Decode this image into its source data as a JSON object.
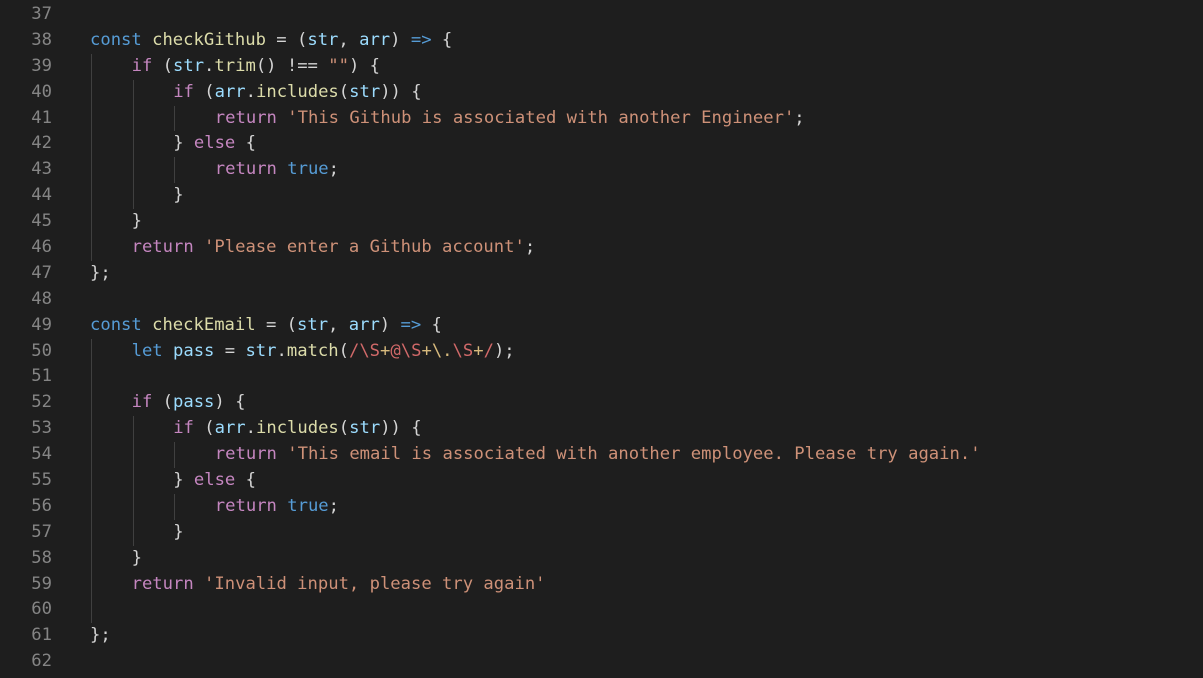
{
  "colors": {
    "background": "#1e1e1e",
    "line_number": "#858585",
    "default": "#d4d4d4",
    "storage": "#569cd6",
    "function": "#dcdcaa",
    "variable": "#9cdcfe",
    "control": "#c586c0",
    "string": "#ce9178",
    "regexp": "#d16969",
    "regex_escape": "#d7ba7d",
    "indent_guide": "#404040"
  },
  "editor": {
    "lines": [
      {
        "num": "37",
        "indent": 0,
        "tokens": []
      },
      {
        "num": "38",
        "indent": 0,
        "tokens": [
          {
            "t": "const",
            "k": "storage"
          },
          {
            "t": " ",
            "k": "default"
          },
          {
            "t": "checkGithub",
            "k": "function"
          },
          {
            "t": " = (",
            "k": "default"
          },
          {
            "t": "str",
            "k": "variable"
          },
          {
            "t": ", ",
            "k": "default"
          },
          {
            "t": "arr",
            "k": "variable"
          },
          {
            "t": ") ",
            "k": "default"
          },
          {
            "t": "=>",
            "k": "storage"
          },
          {
            "t": " {",
            "k": "default"
          }
        ]
      },
      {
        "num": "39",
        "indent": 1,
        "tokens": [
          {
            "t": "if",
            "k": "control"
          },
          {
            "t": " (",
            "k": "default"
          },
          {
            "t": "str",
            "k": "variable"
          },
          {
            "t": ".",
            "k": "default"
          },
          {
            "t": "trim",
            "k": "function"
          },
          {
            "t": "() !== ",
            "k": "default"
          },
          {
            "t": "\"\"",
            "k": "string"
          },
          {
            "t": ") {",
            "k": "default"
          }
        ]
      },
      {
        "num": "40",
        "indent": 2,
        "tokens": [
          {
            "t": "if",
            "k": "control"
          },
          {
            "t": " (",
            "k": "default"
          },
          {
            "t": "arr",
            "k": "variable"
          },
          {
            "t": ".",
            "k": "default"
          },
          {
            "t": "includes",
            "k": "function"
          },
          {
            "t": "(",
            "k": "default"
          },
          {
            "t": "str",
            "k": "variable"
          },
          {
            "t": ")) {",
            "k": "default"
          }
        ]
      },
      {
        "num": "41",
        "indent": 3,
        "tokens": [
          {
            "t": "return",
            "k": "control"
          },
          {
            "t": " ",
            "k": "default"
          },
          {
            "t": "'This Github is associated with another Engineer'",
            "k": "string"
          },
          {
            "t": ";",
            "k": "default"
          }
        ]
      },
      {
        "num": "42",
        "indent": 2,
        "tokens": [
          {
            "t": "} ",
            "k": "default"
          },
          {
            "t": "else",
            "k": "control"
          },
          {
            "t": " {",
            "k": "default"
          }
        ]
      },
      {
        "num": "43",
        "indent": 3,
        "tokens": [
          {
            "t": "return",
            "k": "control"
          },
          {
            "t": " ",
            "k": "default"
          },
          {
            "t": "true",
            "k": "storage"
          },
          {
            "t": ";",
            "k": "default"
          }
        ]
      },
      {
        "num": "44",
        "indent": 2,
        "tokens": [
          {
            "t": "}",
            "k": "default"
          }
        ]
      },
      {
        "num": "45",
        "indent": 1,
        "tokens": [
          {
            "t": "}",
            "k": "default"
          }
        ]
      },
      {
        "num": "46",
        "indent": 1,
        "tokens": [
          {
            "t": "return",
            "k": "control"
          },
          {
            "t": " ",
            "k": "default"
          },
          {
            "t": "'Please enter a Github account'",
            "k": "string"
          },
          {
            "t": ";",
            "k": "default"
          }
        ]
      },
      {
        "num": "47",
        "indent": 0,
        "tokens": [
          {
            "t": "};",
            "k": "default"
          }
        ]
      },
      {
        "num": "48",
        "indent": 0,
        "tokens": []
      },
      {
        "num": "49",
        "indent": 0,
        "tokens": [
          {
            "t": "const",
            "k": "storage"
          },
          {
            "t": " ",
            "k": "default"
          },
          {
            "t": "checkEmail",
            "k": "function"
          },
          {
            "t": " = (",
            "k": "default"
          },
          {
            "t": "str",
            "k": "variable"
          },
          {
            "t": ", ",
            "k": "default"
          },
          {
            "t": "arr",
            "k": "variable"
          },
          {
            "t": ") ",
            "k": "default"
          },
          {
            "t": "=>",
            "k": "storage"
          },
          {
            "t": " {",
            "k": "default"
          }
        ]
      },
      {
        "num": "50",
        "indent": 1,
        "tokens": [
          {
            "t": "let",
            "k": "storage"
          },
          {
            "t": " ",
            "k": "default"
          },
          {
            "t": "pass",
            "k": "variable"
          },
          {
            "t": " = ",
            "k": "default"
          },
          {
            "t": "str",
            "k": "variable"
          },
          {
            "t": ".",
            "k": "default"
          },
          {
            "t": "match",
            "k": "function"
          },
          {
            "t": "(",
            "k": "default"
          },
          {
            "t": "/",
            "k": "regexp"
          },
          {
            "t": "\\S",
            "k": "regexp"
          },
          {
            "t": "+",
            "k": "regex_escape"
          },
          {
            "t": "@",
            "k": "regexp"
          },
          {
            "t": "\\S",
            "k": "regexp"
          },
          {
            "t": "+",
            "k": "regex_escape"
          },
          {
            "t": "\\.",
            "k": "regex_escape"
          },
          {
            "t": "\\S",
            "k": "regexp"
          },
          {
            "t": "+",
            "k": "regex_escape"
          },
          {
            "t": "/",
            "k": "regexp"
          },
          {
            "t": ");",
            "k": "default"
          }
        ]
      },
      {
        "num": "51",
        "indent": 1,
        "tokens": []
      },
      {
        "num": "52",
        "indent": 1,
        "tokens": [
          {
            "t": "if",
            "k": "control"
          },
          {
            "t": " (",
            "k": "default"
          },
          {
            "t": "pass",
            "k": "variable"
          },
          {
            "t": ") {",
            "k": "default"
          }
        ]
      },
      {
        "num": "53",
        "indent": 2,
        "tokens": [
          {
            "t": "if",
            "k": "control"
          },
          {
            "t": " (",
            "k": "default"
          },
          {
            "t": "arr",
            "k": "variable"
          },
          {
            "t": ".",
            "k": "default"
          },
          {
            "t": "includes",
            "k": "function"
          },
          {
            "t": "(",
            "k": "default"
          },
          {
            "t": "str",
            "k": "variable"
          },
          {
            "t": ")) {",
            "k": "default"
          }
        ]
      },
      {
        "num": "54",
        "indent": 3,
        "tokens": [
          {
            "t": "return",
            "k": "control"
          },
          {
            "t": " ",
            "k": "default"
          },
          {
            "t": "'This email is associated with another employee. Please try again.'",
            "k": "string"
          }
        ]
      },
      {
        "num": "55",
        "indent": 2,
        "tokens": [
          {
            "t": "} ",
            "k": "default"
          },
          {
            "t": "else",
            "k": "control"
          },
          {
            "t": " {",
            "k": "default"
          }
        ]
      },
      {
        "num": "56",
        "indent": 3,
        "tokens": [
          {
            "t": "return",
            "k": "control"
          },
          {
            "t": " ",
            "k": "default"
          },
          {
            "t": "true",
            "k": "storage"
          },
          {
            "t": ";",
            "k": "default"
          }
        ]
      },
      {
        "num": "57",
        "indent": 2,
        "tokens": [
          {
            "t": "}",
            "k": "default"
          }
        ]
      },
      {
        "num": "58",
        "indent": 1,
        "tokens": [
          {
            "t": "}",
            "k": "default"
          }
        ]
      },
      {
        "num": "59",
        "indent": 1,
        "tokens": [
          {
            "t": "return",
            "k": "control"
          },
          {
            "t": " ",
            "k": "default"
          },
          {
            "t": "'Invalid input, please try again'",
            "k": "string"
          }
        ]
      },
      {
        "num": "60",
        "indent": 1,
        "tokens": []
      },
      {
        "num": "61",
        "indent": 0,
        "tokens": [
          {
            "t": "};",
            "k": "default"
          }
        ]
      },
      {
        "num": "62",
        "indent": 0,
        "tokens": []
      }
    ]
  }
}
